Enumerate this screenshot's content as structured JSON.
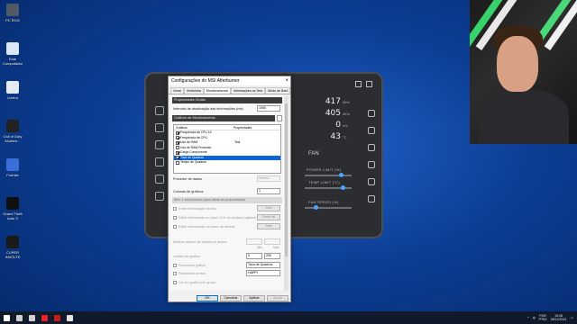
{
  "desktop": {
    "icons": [
      {
        "label": "PC ROG",
        "color": "#4f5a66"
      },
      {
        "label": "Este Computador",
        "color": "#d9e8f6"
      },
      {
        "label": "Lixeira",
        "color": "#e5ecf3"
      },
      {
        "label": "Call of Duty Modern...",
        "color": "#222222"
      },
      {
        "label": "Fortnite",
        "color": "#3a6ed8"
      },
      {
        "label": "Grand Theft Auto V",
        "color": "#101010"
      },
      {
        "label": "CUPER INVOLTE",
        "color": "#1a1a1a"
      }
    ]
  },
  "afterburner": {
    "readouts": [
      {
        "value": "417",
        "unit": "MHz"
      },
      {
        "value": "405",
        "unit": "MHz"
      },
      {
        "value": "0",
        "unit": "mV"
      },
      {
        "value": "43",
        "unit": "°C"
      }
    ],
    "fan_label": "FAN",
    "power_limit_label": "POWER LIMIT (%)",
    "temp_limit_label": "TEMP LIMIT (°C)",
    "fan_speed_label": "FAN SPEED (%)"
  },
  "dialog": {
    "title": "Configurações do MSI Afterburner",
    "close": "×",
    "tabs": [
      "Geral",
      "Ventoinha",
      "Monitoramento",
      "Informações na Tela",
      "Modo de Bani"
    ],
    "active_tab": 2,
    "properties_bar": "Propriedades Gerais",
    "interval_label": "Intervalo de atualização das informações (ms)",
    "interval_value": "1000",
    "active_graphs_bar": "Gráficos de Monitoramento",
    "graphs_header": {
      "name": "Gráficos",
      "props": "Propriedades"
    },
    "graphs": [
      {
        "name": "Frequência da CPU 16",
        "prop": "",
        "checked": true,
        "selected": false
      },
      {
        "name": "Frequência da CPU",
        "prop": "",
        "checked": true,
        "selected": false
      },
      {
        "name": "Uso de RAM",
        "prop": "Tela",
        "checked": true,
        "selected": false
      },
      {
        "name": "Uso de RAM Processo",
        "prop": "",
        "checked": false,
        "selected": false
      },
      {
        "name": "Carga Componente",
        "prop": "",
        "checked": true,
        "selected": false
      },
      {
        "name": "Taxa de Quadros",
        "prop": "",
        "checked": true,
        "selected": true
      },
      {
        "name": "Tempo de Quadros",
        "prop": "",
        "checked": false,
        "selected": false
      }
    ],
    "data_provider_label": "Provedor de dados",
    "data_provider_value": "Interno",
    "columns_label": "Colunas de gráficos",
    "columns_value": "1",
    "columns_hint": "Item 1 selecionado para ativar as propriedades",
    "options": [
      {
        "label": "Exibir informação na tela",
        "button": "Texto"
      },
      {
        "label": "Exibir informação no visor LCD do teclado Logitech",
        "button": "Fonte full"
      },
      {
        "label": "Exibir informação na barra de tarefas",
        "button": "Texto"
      }
    ],
    "alarm_label": "Mostrar alarme se abaixo ou acima",
    "min_label": "Min",
    "max_label": "Max",
    "graph_limits_label": "Limites do gráfico",
    "graph_limit_min": "0",
    "graph_limit_max": "200",
    "rename_graph_label": "Renomear gráfico",
    "rename_graph_value": "Taxa de Quadros",
    "rename_sensor_label": "Renomear sensor",
    "rename_sensor_value": "HAPPI",
    "group_label": "Cor do gráfico em grupo",
    "buttons": {
      "ok": "OK",
      "cancel": "Cancelar",
      "apply": "Aplicar",
      "help": "Ajuda"
    }
  },
  "taskbar": {
    "icons": [
      {
        "name": "windows-start-icon",
        "color": "#ffffff"
      },
      {
        "name": "search-icon",
        "color": "#d0d0d0"
      },
      {
        "name": "task-view-icon",
        "color": "#d0d0d0"
      },
      {
        "name": "opera-icon",
        "color": "#e8212a"
      },
      {
        "name": "afterburner-icon",
        "color": "#c21d1d"
      },
      {
        "name": "app-icon",
        "color": "#e3e3e3"
      }
    ],
    "lang": "POR",
    "lang_sub": "PTB2",
    "time": "15:08",
    "date": "28/12/2021"
  },
  "colors": {
    "accent": "#0a64d6",
    "desktop": "#0d3f97",
    "skin": "#2b2d31"
  }
}
